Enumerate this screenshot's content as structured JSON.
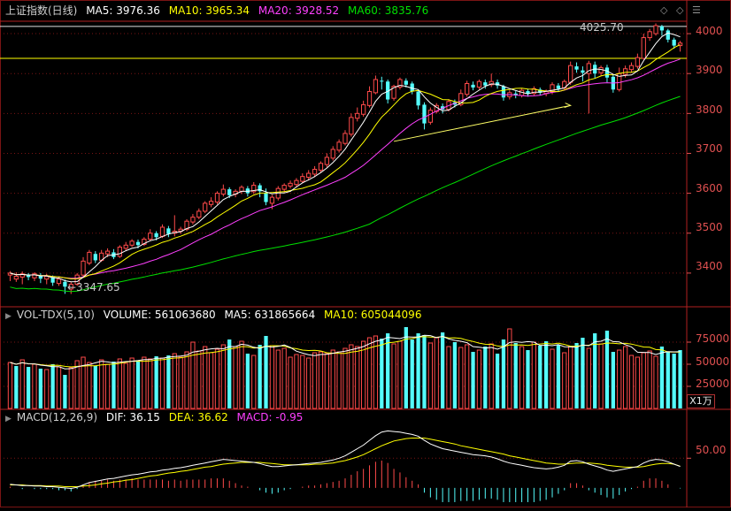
{
  "price_panel": {
    "legend": {
      "title": "上证指数(日线)",
      "ma5": "MA5: 3976.36",
      "ma10": "MA10: 3965.34",
      "ma20": "MA20: 3928.52",
      "ma60": "MA60: 3835.76"
    },
    "annotations": {
      "high_label": "4025.70",
      "low_label": "←3347.65"
    },
    "y_ticks": [
      "4000",
      "3900",
      "3800",
      "3700",
      "3600",
      "3500",
      "3400"
    ]
  },
  "volume_panel": {
    "legend": {
      "title": "VOL-TDX(5,10)",
      "volume": "VOLUME: 561063680",
      "ma5": "MA5: 631865664",
      "ma10": "MA10: 605044096"
    },
    "y_ticks": [
      "75000",
      "50000",
      "25000"
    ],
    "unit": "X1万"
  },
  "macd_panel": {
    "legend": {
      "title": "MACD(12,26,9)",
      "dif": "DIF: 36.15",
      "dea": "DEA: 36.62",
      "macd": "MACD: -0.95"
    },
    "y_ticks": [
      "50.00"
    ]
  },
  "colors": {
    "up": "#ff4a4a",
    "down": "#54fcfc",
    "ma5": "#ffffff",
    "ma10": "#ffff00",
    "ma20": "#ff40ff",
    "ma60": "#00e000",
    "grid": "#7a1414",
    "axis_text": "#e05050"
  },
  "chart_data": [
    {
      "type": "candlestick",
      "title": "上证指数(日线)",
      "y_range": [
        3320,
        4040
      ],
      "candles": [
        [
          3395,
          3400,
          3380,
          3405
        ],
        [
          3385,
          3392,
          3378,
          3402
        ],
        [
          3390,
          3398,
          3372,
          3404
        ],
        [
          3395,
          3390,
          3382,
          3400
        ],
        [
          3388,
          3398,
          3380,
          3402
        ],
        [
          3394,
          3386,
          3375,
          3400
        ],
        [
          3385,
          3392,
          3372,
          3398
        ],
        [
          3390,
          3376,
          3368,
          3394
        ],
        [
          3374,
          3385,
          3368,
          3390
        ],
        [
          3378,
          3366,
          3348,
          3384
        ],
        [
          3360,
          3372,
          3347.65,
          3378
        ],
        [
          3372,
          3395,
          3368,
          3400
        ],
        [
          3395,
          3430,
          3390,
          3440
        ],
        [
          3425,
          3452,
          3420,
          3458
        ],
        [
          3448,
          3432,
          3425,
          3455
        ],
        [
          3432,
          3450,
          3428,
          3458
        ],
        [
          3448,
          3455,
          3440,
          3462
        ],
        [
          3452,
          3440,
          3435,
          3460
        ],
        [
          3442,
          3465,
          3438,
          3470
        ],
        [
          3462,
          3470,
          3455,
          3478
        ],
        [
          3470,
          3480,
          3465,
          3485
        ],
        [
          3478,
          3470,
          3462,
          3484
        ],
        [
          3472,
          3485,
          3468,
          3490
        ],
        [
          3485,
          3500,
          3480,
          3510
        ],
        [
          3500,
          3490,
          3482,
          3505
        ],
        [
          3492,
          3515,
          3488,
          3522
        ],
        [
          3512,
          3498,
          3490,
          3518
        ],
        [
          3500,
          3505,
          3492,
          3545
        ],
        [
          3505,
          3510,
          3498,
          3516
        ],
        [
          3510,
          3530,
          3505,
          3535
        ],
        [
          3528,
          3540,
          3522,
          3548
        ],
        [
          3540,
          3555,
          3535,
          3562
        ],
        [
          3555,
          3575,
          3550,
          3580
        ],
        [
          3572,
          3580,
          3565,
          3590
        ],
        [
          3578,
          3600,
          3572,
          3605
        ],
        [
          3598,
          3610,
          3592,
          3622
        ],
        [
          3610,
          3595,
          3588,
          3615
        ],
        [
          3598,
          3605,
          3590,
          3610
        ],
        [
          3605,
          3615,
          3598,
          3620
        ],
        [
          3612,
          3600,
          3592,
          3618
        ],
        [
          3604,
          3620,
          3598,
          3628
        ],
        [
          3620,
          3605,
          3590,
          3625
        ],
        [
          3600,
          3578,
          3570,
          3612
        ],
        [
          3575,
          3590,
          3560,
          3596
        ],
        [
          3588,
          3612,
          3582,
          3618
        ],
        [
          3610,
          3620,
          3602,
          3625
        ],
        [
          3618,
          3625,
          3612,
          3632
        ],
        [
          3622,
          3632,
          3615,
          3638
        ],
        [
          3630,
          3642,
          3625,
          3650
        ],
        [
          3640,
          3650,
          3632,
          3658
        ],
        [
          3648,
          3660,
          3640,
          3668
        ],
        [
          3658,
          3675,
          3652,
          3680
        ],
        [
          3672,
          3690,
          3665,
          3700
        ],
        [
          3688,
          3710,
          3682,
          3718
        ],
        [
          3708,
          3728,
          3702,
          3735
        ],
        [
          3725,
          3750,
          3720,
          3758
        ],
        [
          3748,
          3790,
          3742,
          3800
        ],
        [
          3788,
          3800,
          3780,
          3815
        ],
        [
          3798,
          3822,
          3792,
          3832
        ],
        [
          3820,
          3855,
          3815,
          3868
        ],
        [
          3852,
          3885,
          3848,
          3895
        ],
        [
          3882,
          3880,
          3860,
          3892
        ],
        [
          3880,
          3835,
          3825,
          3885
        ],
        [
          3838,
          3868,
          3832,
          3872
        ],
        [
          3866,
          3885,
          3860,
          3890
        ],
        [
          3882,
          3872,
          3865,
          3888
        ],
        [
          3875,
          3855,
          3848,
          3880
        ],
        [
          3855,
          3820,
          3810,
          3860
        ],
        [
          3822,
          3775,
          3760,
          3828
        ],
        [
          3778,
          3808,
          3772,
          3815
        ],
        [
          3805,
          3820,
          3800,
          3826
        ],
        [
          3818,
          3810,
          3800,
          3825
        ],
        [
          3810,
          3830,
          3805,
          3836
        ],
        [
          3828,
          3822,
          3815,
          3835
        ],
        [
          3822,
          3850,
          3818,
          3860
        ],
        [
          3848,
          3875,
          3842,
          3882
        ],
        [
          3872,
          3865,
          3858,
          3880
        ],
        [
          3866,
          3880,
          3860,
          3885
        ],
        [
          3878,
          3870,
          3862,
          3885
        ],
        [
          3872,
          3880,
          3866,
          3900
        ],
        [
          3878,
          3870,
          3862,
          3885
        ],
        [
          3868,
          3840,
          3832,
          3872
        ],
        [
          3842,
          3852,
          3835,
          3858
        ],
        [
          3850,
          3845,
          3838,
          3856
        ],
        [
          3845,
          3858,
          3840,
          3862
        ],
        [
          3856,
          3850,
          3842,
          3862
        ],
        [
          3850,
          3862,
          3845,
          3868
        ],
        [
          3860,
          3852,
          3845,
          3865
        ],
        [
          3850,
          3855,
          3843,
          3860
        ],
        [
          3854,
          3872,
          3848,
          3878
        ],
        [
          3870,
          3862,
          3855,
          3876
        ],
        [
          3864,
          3880,
          3858,
          3885
        ],
        [
          3878,
          3920,
          3872,
          3930
        ],
        [
          3918,
          3910,
          3902,
          3928
        ],
        [
          3908,
          3902,
          3880,
          3918
        ],
        [
          3900,
          3925,
          3800,
          3932
        ],
        [
          3922,
          3900,
          3888,
          3930
        ],
        [
          3902,
          3915,
          3895,
          3920
        ],
        [
          3915,
          3890,
          3878,
          3922
        ],
        [
          3892,
          3860,
          3852,
          3898
        ],
        [
          3860,
          3900,
          3855,
          3915
        ],
        [
          3898,
          3912,
          3890,
          3920
        ],
        [
          3910,
          3920,
          3902,
          3928
        ],
        [
          3918,
          3940,
          3912,
          3950
        ],
        [
          3938,
          3990,
          3935,
          4000
        ],
        [
          3990,
          4005,
          3982,
          4012
        ],
        [
          4000,
          4020,
          3995,
          4025.7
        ],
        [
          4018,
          4008,
          3995,
          4022
        ],
        [
          4008,
          3985,
          3978,
          4012
        ],
        [
          3985,
          3970,
          3962,
          3990
        ],
        [
          3970,
          3976.36,
          3955,
          3982
        ]
      ],
      "ma5_last": 3976.36,
      "ma10_last": 3965.34,
      "ma20_last": 3928.52,
      "ma60_last": 3835.76,
      "high": 4025.7,
      "low": 3347.65
    },
    {
      "type": "bar",
      "title": "VOL-TDX(5,10)",
      "y_range": [
        0,
        100000
      ],
      "unit": "X1万",
      "values": [
        52000,
        48000,
        55000,
        47000,
        50000,
        45000,
        44000,
        50000,
        47000,
        38000,
        46000,
        54000,
        58000,
        52000,
        48000,
        55000,
        50000,
        53000,
        56000,
        51000,
        57000,
        54000,
        58000,
        56000,
        59000,
        57000,
        60000,
        62000,
        58000,
        64000,
        75000,
        65000,
        70000,
        63000,
        67000,
        72000,
        78000,
        70000,
        76000,
        62000,
        60000,
        72000,
        82000,
        71000,
        66000,
        68000,
        58000,
        61000,
        60000,
        57000,
        63000,
        64000,
        62000,
        66000,
        64000,
        68000,
        72000,
        70000,
        76000,
        80000,
        82000,
        79000,
        85000,
        73000,
        76000,
        92000,
        78000,
        85000,
        83000,
        74000,
        80000,
        86000,
        70000,
        75000,
        69000,
        72000,
        64000,
        66000,
        70000,
        73000,
        62000,
        78000,
        90000,
        74000,
        70000,
        66000,
        75000,
        71000,
        76000,
        67000,
        72000,
        63000,
        70000,
        74000,
        80000,
        68000,
        85000,
        73000,
        88000,
        64000,
        66000,
        70000,
        60000,
        58000,
        63000,
        65000,
        59000,
        70000,
        64000,
        62000,
        66000,
        68000,
        61000,
        56106
      ],
      "up": [
        1,
        0,
        1,
        0,
        1,
        0,
        1,
        0,
        1,
        0,
        1,
        1,
        1,
        1,
        0,
        1,
        1,
        0,
        1,
        1,
        1,
        0,
        1,
        1,
        0,
        1,
        0,
        1,
        1,
        1,
        1,
        1,
        1,
        1,
        1,
        1,
        0,
        1,
        1,
        0,
        1,
        0,
        0,
        1,
        1,
        1,
        1,
        1,
        1,
        1,
        1,
        1,
        1,
        1,
        1,
        1,
        1,
        1,
        1,
        1,
        1,
        0,
        0,
        1,
        1,
        0,
        0,
        0,
        0,
        1,
        1,
        0,
        1,
        0,
        1,
        1,
        0,
        1,
        0,
        1,
        0,
        0,
        1,
        0,
        1,
        0,
        1,
        0,
        0,
        1,
        0,
        1,
        1,
        0,
        0,
        1,
        0,
        1,
        0,
        0,
        1,
        1,
        1,
        1,
        1,
        1,
        1,
        0,
        0,
        0,
        0,
        0
      ],
      "ma5_last": 631865664,
      "ma10_last": 605044096,
      "volume_last": 561063680
    },
    {
      "type": "line",
      "title": "MACD(12,26,9)",
      "y_range": [
        -30,
        110
      ],
      "dif_last": 36.15,
      "dea_last": 36.62,
      "macd_last": -0.95,
      "dif": [
        6,
        5,
        4,
        4,
        3,
        3,
        2,
        2,
        1,
        0,
        -1,
        1,
        5,
        9,
        11,
        13,
        15,
        16,
        18,
        20,
        22,
        23,
        25,
        27,
        28,
        30,
        31,
        33,
        34,
        36,
        38,
        40,
        42,
        44,
        46,
        48,
        47,
        46,
        45,
        44,
        43,
        41,
        38,
        36,
        36,
        37,
        38,
        39,
        40,
        41,
        42,
        43,
        45,
        47,
        50,
        54,
        60,
        66,
        72,
        80,
        88,
        94,
        96,
        95,
        94,
        92,
        90,
        87,
        80,
        74,
        70,
        66,
        64,
        62,
        60,
        58,
        56,
        55,
        54,
        52,
        49,
        45,
        42,
        40,
        38,
        36,
        34,
        33,
        32,
        33,
        35,
        38,
        45,
        46,
        44,
        40,
        37,
        34,
        30,
        28,
        30,
        32,
        34,
        36,
        42,
        46,
        48,
        47,
        44,
        40,
        36.15
      ],
      "dea": [
        5,
        5,
        5,
        4,
        4,
        4,
        3,
        3,
        3,
        2,
        2,
        2,
        3,
        4,
        5,
        7,
        8,
        10,
        11,
        13,
        14,
        16,
        18,
        20,
        21,
        23,
        25,
        26,
        28,
        29,
        31,
        33,
        35,
        36,
        38,
        40,
        41,
        42,
        43,
        43,
        43,
        43,
        42,
        41,
        40,
        39,
        39,
        39,
        39,
        39,
        40,
        40,
        41,
        42,
        44,
        46,
        49,
        52,
        56,
        61,
        66,
        71,
        75,
        79,
        81,
        83,
        84,
        84,
        84,
        82,
        80,
        78,
        76,
        74,
        71,
        69,
        67,
        65,
        63,
        61,
        59,
        57,
        54,
        52,
        50,
        48,
        46,
        44,
        42,
        41,
        40,
        40,
        41,
        42,
        42,
        42,
        41,
        40,
        38,
        37,
        36,
        35,
        35,
        35,
        36,
        38,
        40,
        41,
        41,
        40,
        36.62
      ]
    }
  ]
}
